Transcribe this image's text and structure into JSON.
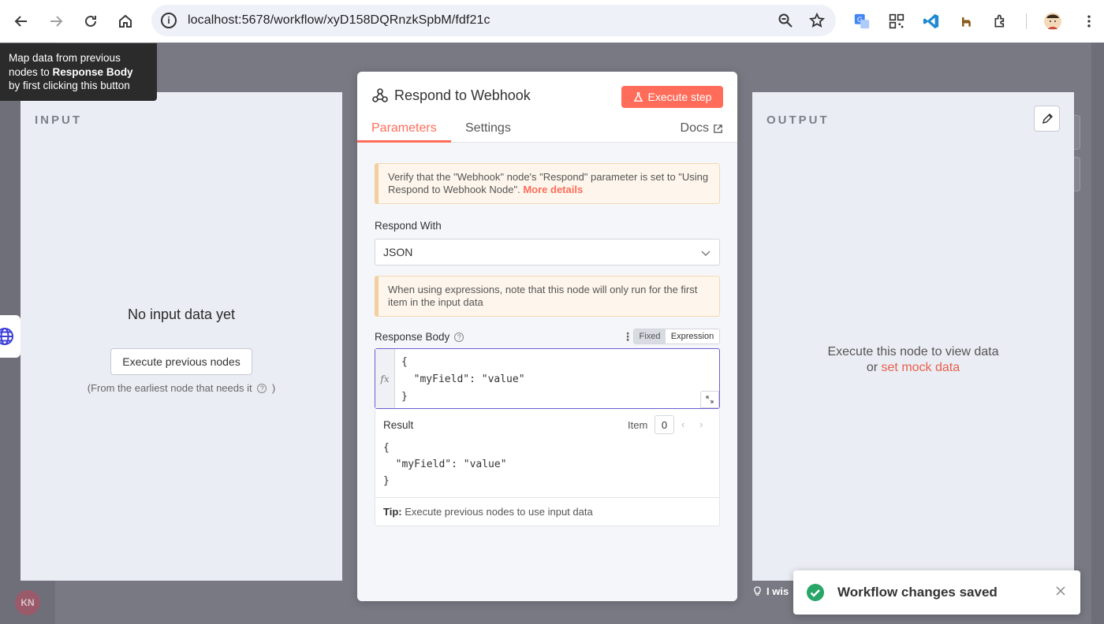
{
  "browser": {
    "url": "localhost:5678/workflow/xyD158DQRnzkSpbM/fdf21c"
  },
  "tooltip": {
    "line1": "Map data from previous",
    "line2_prefix": "nodes to ",
    "line2_bold": "Response Body",
    "line3": "by first clicking this button"
  },
  "app": {
    "avatar_initials": "KN",
    "hint_partial": "I wis"
  },
  "input_panel": {
    "title": "INPUT",
    "empty_title": "No input data yet",
    "execute_button": "Execute previous nodes",
    "earliest_note": "(From the earliest node that needs it",
    "earliest_suffix": ")"
  },
  "output_panel": {
    "title": "OUTPUT",
    "message_line1": "Execute this node to view data",
    "message_or": "or ",
    "mock_link": "set mock data"
  },
  "node": {
    "title": "Respond to Webhook",
    "execute_step": "Execute step",
    "tabs": [
      {
        "label": "Parameters",
        "active": true
      },
      {
        "label": "Settings",
        "active": false
      }
    ],
    "docs": "Docs",
    "notice1_text": "Verify that the \"Webhook\" node's \"Respond\" parameter is set to \"Using Respond to Webhook Node\".",
    "notice1_link": "More details",
    "respond_with_label": "Respond With",
    "respond_with_value": "JSON",
    "notice2_text": "When using expressions, note that this node will only run for the first item in the input data",
    "response_body_label": "Response Body",
    "toggle_fixed": "Fixed",
    "toggle_expression": "Expression",
    "fx": "fx",
    "code_lines": [
      "{",
      "  \"myField\": \"value\"",
      "}"
    ],
    "result_label": "Result",
    "item_label": "Item",
    "item_value": "0",
    "result_lines": [
      "{",
      "  \"myField\": \"value\"",
      "}"
    ],
    "tip_bold": "Tip:",
    "tip_text": " Execute previous nodes to use input data"
  },
  "toast": {
    "message": "Workflow changes saved"
  },
  "colors": {
    "accent": "#ff6d5a",
    "expression_border": "#6b5fd3",
    "success": "#29a568"
  }
}
